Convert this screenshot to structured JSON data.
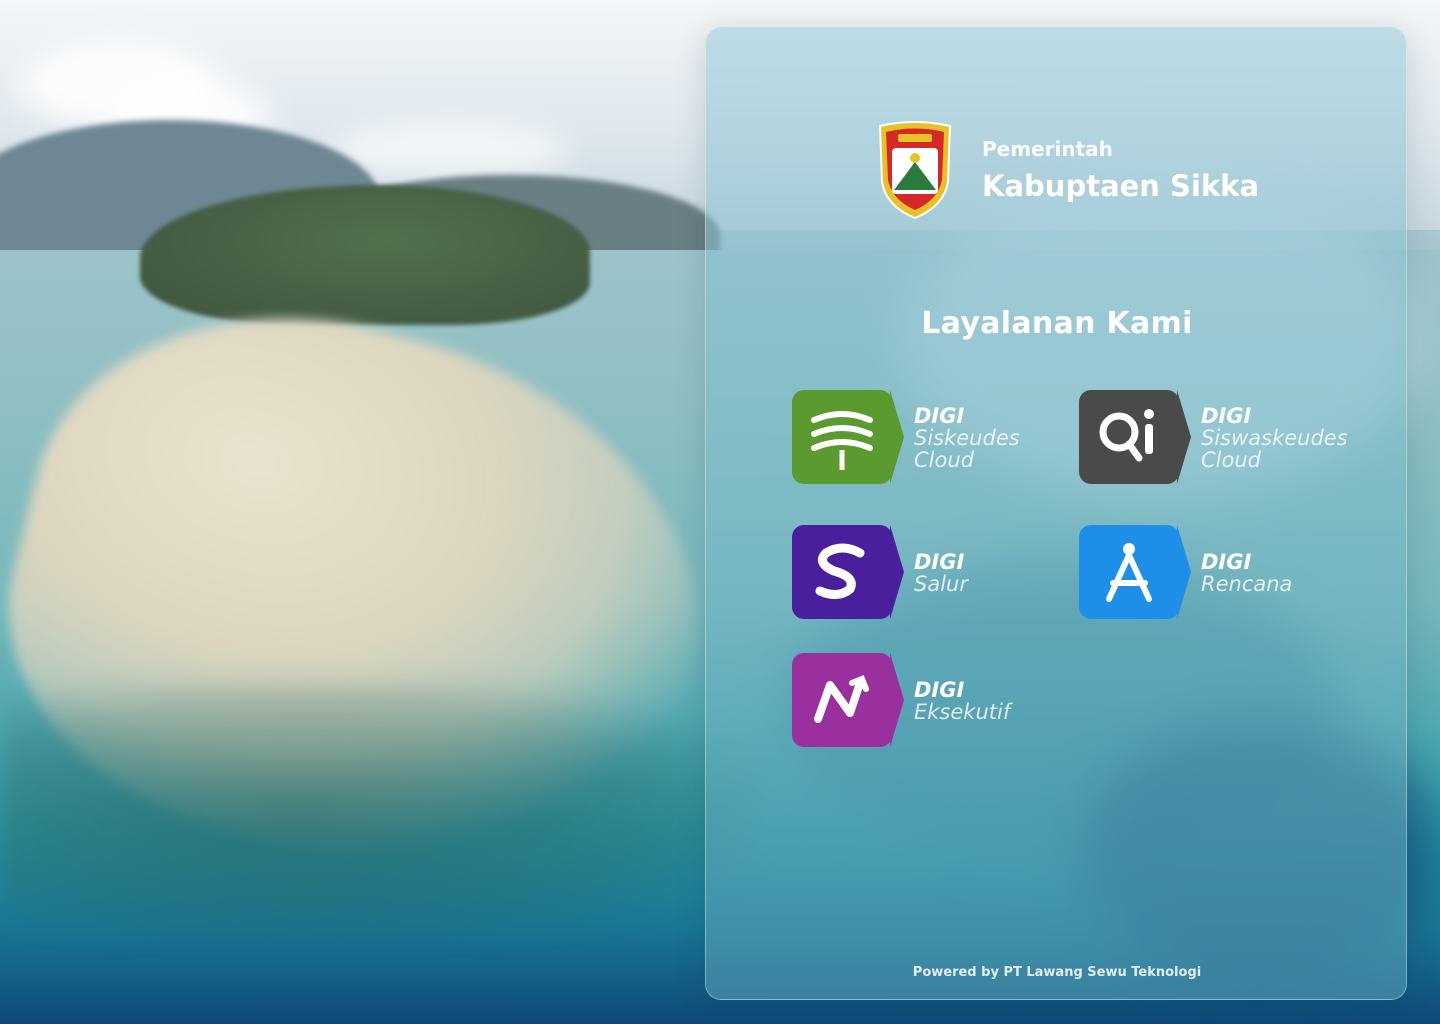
{
  "header": {
    "subtitle": "Pemerintah",
    "title": "Kabuptaen Sikka",
    "logo": "kabupaten-sikka-crest"
  },
  "section": {
    "title": "Layalanan Kami"
  },
  "services": [
    {
      "brand": "DIGI",
      "name_line1": "Siskeudes",
      "name_line2": "Cloud",
      "icon": "wheat-leaf-icon",
      "color": "#5a9a2e"
    },
    {
      "brand": "DIGI",
      "name_line1": "Siswaskeudes",
      "name_line2": "Cloud",
      "icon": "qi-magnifier-icon",
      "color": "#4a4a4a"
    },
    {
      "brand": "DIGI",
      "name_line1": "Salur",
      "name_line2": "",
      "icon": "s-letter-icon",
      "color": "#4a1f9e"
    },
    {
      "brand": "DIGI",
      "name_line1": "Rencana",
      "name_line2": "",
      "icon": "compass-drafting-icon",
      "color": "#1e8fe8"
    },
    {
      "brand": "DIGI",
      "name_line1": "Eksekutif",
      "name_line2": "",
      "icon": "n-arrow-icon",
      "color": "#9a2f9e"
    }
  ],
  "footer": {
    "text": "Powered by PT Lawang Sewu Teknologi"
  }
}
